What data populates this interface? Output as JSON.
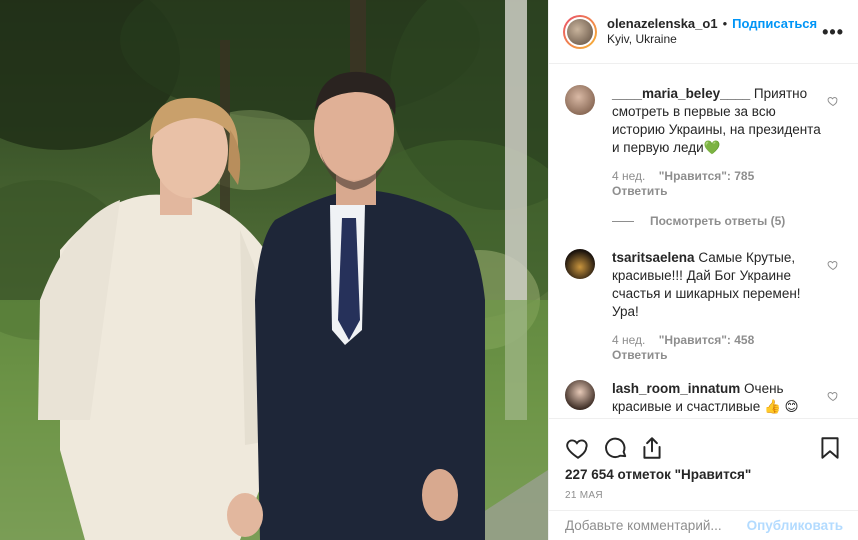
{
  "post": {
    "username": "olenazelenska_o1",
    "separator": "•",
    "follow_label": "Подписаться",
    "location": "Kyiv, Ukraine",
    "more_label": "•••"
  },
  "comments": [
    {
      "username": "____maria_beley____",
      "text": "Приятно смотреть в первые за всю историю Украины, на президента и первую леди💚",
      "time": "4 нед.",
      "likes": "\"Нравится\": 785",
      "reply": "Ответить",
      "view_replies": "Посмотреть ответы (5)"
    },
    {
      "username": "tsaritsaelena",
      "text": "Самые Крутые, красивые!!! Дай Бог Украине счастья и шикарных перемен! Ура!",
      "time": "4 нед.",
      "likes": "\"Нравится\": 458",
      "reply": "Ответить"
    },
    {
      "username": "lash_room_innatum",
      "text": "Очень красивые и счастливые 👍 😊"
    }
  ],
  "actions": {
    "like_count": "227 654 отметок \"Нравится\"",
    "date": "21 мая"
  },
  "add_comment": {
    "placeholder": "Добавьте комментарий...",
    "publish_label": "Опубликовать"
  },
  "colors": {
    "accent": "#0095f6",
    "muted": "#8e8e8e",
    "publish_disabled": "#b3dbff"
  }
}
